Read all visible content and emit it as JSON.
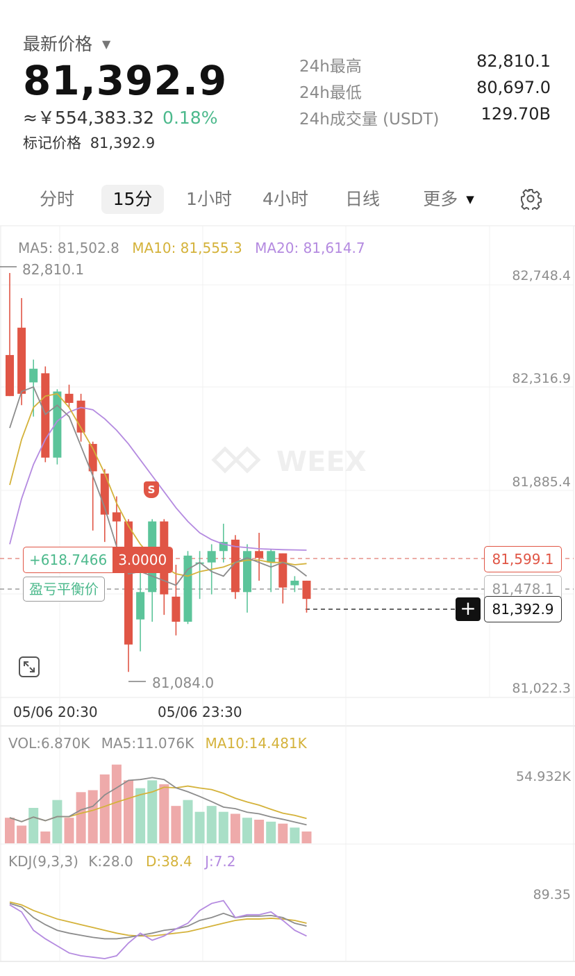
{
  "header": {
    "price_label": "最新价格",
    "price": "81,392.9",
    "cny_prefix": "≈￥",
    "cny_value": "554,383.32",
    "change": "0.18%",
    "mark_label": "标记价格",
    "mark_value": "81,392.9"
  },
  "stats": [
    {
      "label": "24h最高",
      "value": "82,810.1"
    },
    {
      "label": "24h最低",
      "value": "80,697.0"
    },
    {
      "label": "24h成交量 (USDT)",
      "value": "129.70B"
    }
  ],
  "tabs": [
    "分时",
    "15分",
    "1小时",
    "4小时",
    "日线",
    "更多"
  ],
  "active_tab": "15分",
  "chart": {
    "ma5": "MA5: 81,502.8",
    "ma10": "MA10: 81,555.3",
    "ma20": "MA20: 81,614.7",
    "y_labels": [
      "82,748.4",
      "82,316.9",
      "81,885.4",
      "81,022.3"
    ],
    "high_marker": "82,810.1",
    "low_marker": "81,084.0",
    "x_labels": [
      "05/06 20:30",
      "05/06 23:30"
    ],
    "pnl": "+618.7466",
    "position_size": "3.0000",
    "entry_price": "81,599.1",
    "breakeven_label": "盈亏平衡价",
    "breakeven_price": "81,478.1",
    "current_price": "81,392.9",
    "plus_symbol": "+",
    "signal_badge": "S",
    "watermark": "WEEX"
  },
  "volume": {
    "vol": "VOL:6.870K",
    "ma5": "MA5:11.076K",
    "ma10": "MA10:14.481K",
    "y_label": "54.932K"
  },
  "kdj": {
    "title": "KDJ(9,3,3)",
    "k": "K:28.0",
    "d": "D:38.4",
    "j": "J:7.2",
    "y_label": "89.35"
  },
  "colors": {
    "up": "#5cc49a",
    "down": "#e05545",
    "ma5": "#8c8c8c",
    "ma10": "#d4b23a",
    "ma20": "#b48ae0",
    "vol_up": "#a9dfc7",
    "vol_down": "#eeaaaa"
  },
  "chart_data": {
    "type": "candlestick",
    "candles": [
      {
        "open": 82470,
        "close": 82290,
        "high": 82830,
        "low": 82290
      },
      {
        "open": 82590,
        "close": 82300,
        "high": 82720,
        "low": 82250
      },
      {
        "open": 82350,
        "close": 82410,
        "high": 82450,
        "low": 82200
      },
      {
        "open": 82390,
        "close": 82020,
        "high": 82420,
        "low": 82000
      },
      {
        "open": 82020,
        "close": 82310,
        "high": 82320,
        "low": 81990
      },
      {
        "open": 82300,
        "close": 82260,
        "high": 82340,
        "low": 82240
      },
      {
        "open": 82270,
        "close": 82130,
        "high": 82300,
        "low": 82090
      },
      {
        "open": 82080,
        "close": 81960,
        "high": 82090,
        "low": 81700
      },
      {
        "open": 81950,
        "close": 81770,
        "high": 81970,
        "low": 81650
      },
      {
        "open": 81780,
        "close": 81740,
        "high": 81850,
        "low": 81530
      },
      {
        "open": 81740,
        "close": 81200,
        "high": 81750,
        "low": 81080
      },
      {
        "open": 81310,
        "close": 81430,
        "high": 81550,
        "low": 81170
      },
      {
        "open": 81430,
        "close": 81740,
        "high": 81750,
        "low": 81300
      },
      {
        "open": 81740,
        "close": 81420,
        "high": 81750,
        "low": 81330
      },
      {
        "open": 81410,
        "close": 81300,
        "high": 81550,
        "low": 81240
      },
      {
        "open": 81300,
        "close": 81590,
        "high": 81610,
        "low": 81290
      },
      {
        "open": 81560,
        "close": 81560,
        "high": 81610,
        "low": 81400
      },
      {
        "open": 81560,
        "close": 81610,
        "high": 81640,
        "low": 81420
      },
      {
        "open": 81610,
        "close": 81650,
        "high": 81730,
        "low": 81560
      },
      {
        "open": 81660,
        "close": 81430,
        "high": 81680,
        "low": 81400
      },
      {
        "open": 81430,
        "close": 81610,
        "high": 81640,
        "low": 81340
      },
      {
        "open": 81610,
        "close": 81580,
        "high": 81690,
        "low": 81480
      },
      {
        "open": 81560,
        "close": 81610,
        "high": 81620,
        "low": 81430
      },
      {
        "open": 81600,
        "close": 81450,
        "high": 81600,
        "low": 81380
      },
      {
        "open": 81460,
        "close": 81480,
        "high": 81500,
        "low": 81430
      },
      {
        "open": 81480,
        "close": 81400,
        "high": 81480,
        "low": 81340
      }
    ],
    "volumes": [
      13,
      9,
      18,
      6,
      22,
      13,
      26,
      27,
      35,
      40,
      32,
      28,
      32,
      30,
      19,
      22,
      16,
      19,
      16,
      15,
      13,
      12,
      11,
      10,
      8,
      6
    ],
    "ma5_line": [
      82150,
      82310,
      82330,
      82210,
      82250,
      82200,
      82070,
      81940,
      81800,
      81630,
      81510,
      81520,
      81500,
      81480,
      81460,
      81530,
      81560,
      81520,
      81500,
      81560,
      81580,
      81560,
      81540,
      81560,
      81540,
      81500
    ],
    "ma10_line": [
      81900,
      82100,
      82240,
      82290,
      82300,
      82240,
      82150,
      82060,
      81950,
      81820,
      81720,
      81640,
      81580,
      81540,
      81510,
      81500,
      81520,
      81530,
      81540,
      81560,
      81570,
      81570,
      81560,
      81560,
      81550,
      81555
    ],
    "ma20_line": [
      81640,
      81840,
      81990,
      82100,
      82180,
      82220,
      82240,
      82230,
      82190,
      82140,
      82080,
      82010,
      81940,
      81870,
      81800,
      81740,
      81690,
      81660,
      81640,
      81630,
      81625,
      81620,
      81618,
      81616,
      81615,
      81614
    ],
    "k_line": [
      60,
      55,
      40,
      30,
      22,
      18,
      15,
      12,
      10,
      10,
      12,
      15,
      18,
      22,
      24,
      28,
      36,
      40,
      46,
      40,
      42,
      42,
      43,
      40,
      32,
      28
    ],
    "d_line": [
      62,
      58,
      50,
      44,
      38,
      34,
      30,
      26,
      22,
      18,
      15,
      14,
      14,
      16,
      18,
      20,
      24,
      28,
      32,
      36,
      38,
      38,
      39,
      38,
      36,
      32
    ],
    "j_line": [
      58,
      48,
      22,
      10,
      0,
      -10,
      -14,
      -16,
      -18,
      -14,
      4,
      18,
      8,
      14,
      24,
      32,
      50,
      60,
      64,
      40,
      44,
      44,
      48,
      36,
      22,
      14
    ]
  }
}
